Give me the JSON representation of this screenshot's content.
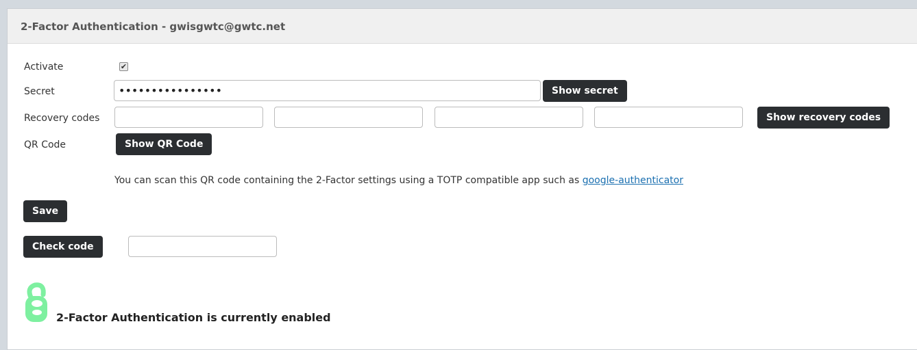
{
  "panel": {
    "title": "2-Factor Authentication - gwisgwtc@gwtc.net"
  },
  "form": {
    "activate_label": "Activate",
    "activate_checked": true,
    "secret_label": "Secret",
    "secret_value": "••••••••••••••••",
    "show_secret_label": "Show secret",
    "recovery_label": "Recovery codes",
    "recovery_values": [
      "",
      "",
      "",
      ""
    ],
    "show_recovery_label": "Show recovery codes",
    "qr_label": "QR Code",
    "show_qr_label": "Show QR Code",
    "info_text": "You can scan this QR code containing the 2-Factor settings using a TOTP compatible app such as ",
    "info_link": "google-authenticator",
    "save_label": "Save",
    "check_code_label": "Check code",
    "check_code_value": ""
  },
  "status": {
    "text": "2-Factor Authentication is currently enabled",
    "icon": "lock-icon",
    "icon_color": "#7ef0a0"
  },
  "colors": {
    "button_bg": "#2b2e31",
    "link": "#1a6fb0",
    "header_bg": "#f0f0f0"
  }
}
